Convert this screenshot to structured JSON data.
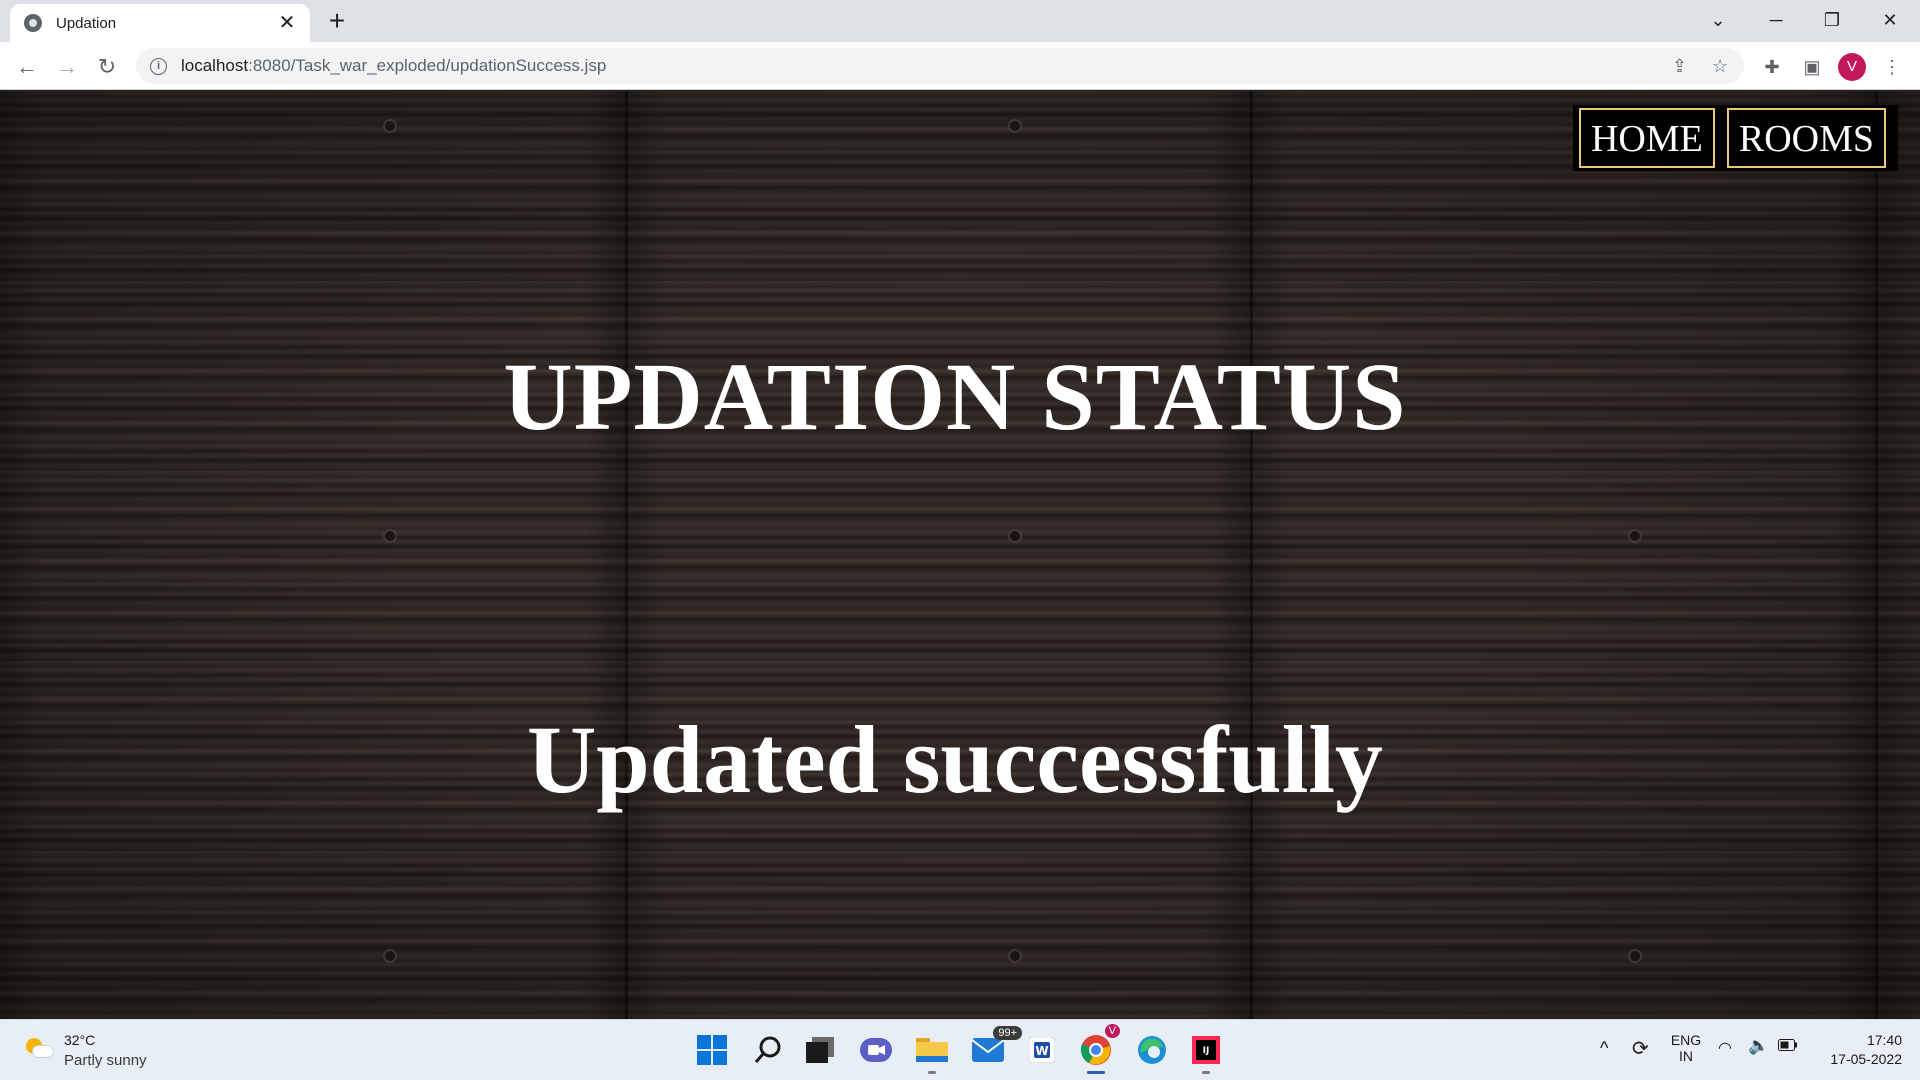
{
  "browser": {
    "tab_title": "Updation",
    "tab_close": "✕",
    "new_tab": "+",
    "url_host": "localhost",
    "url_rest": ":8080/Task_war_exploded/updationSuccess.jsp",
    "profile_initial": "V"
  },
  "page": {
    "nav": [
      "HOME",
      "ROOMS"
    ],
    "heading": "UPDATION STATUS",
    "message": "Updated successfully"
  },
  "taskbar": {
    "weather_temp": "32°C",
    "weather_desc": "Partly sunny",
    "mail_badge": "99+",
    "chrome_badge": "V",
    "lang_top": "ENG",
    "lang_bottom": "IN",
    "time": "17:40",
    "date": "17-05-2022"
  },
  "colors": {
    "nav_border": "#e8c77a",
    "avatar": "#c2185b",
    "taskbar": "#e8eef5"
  }
}
